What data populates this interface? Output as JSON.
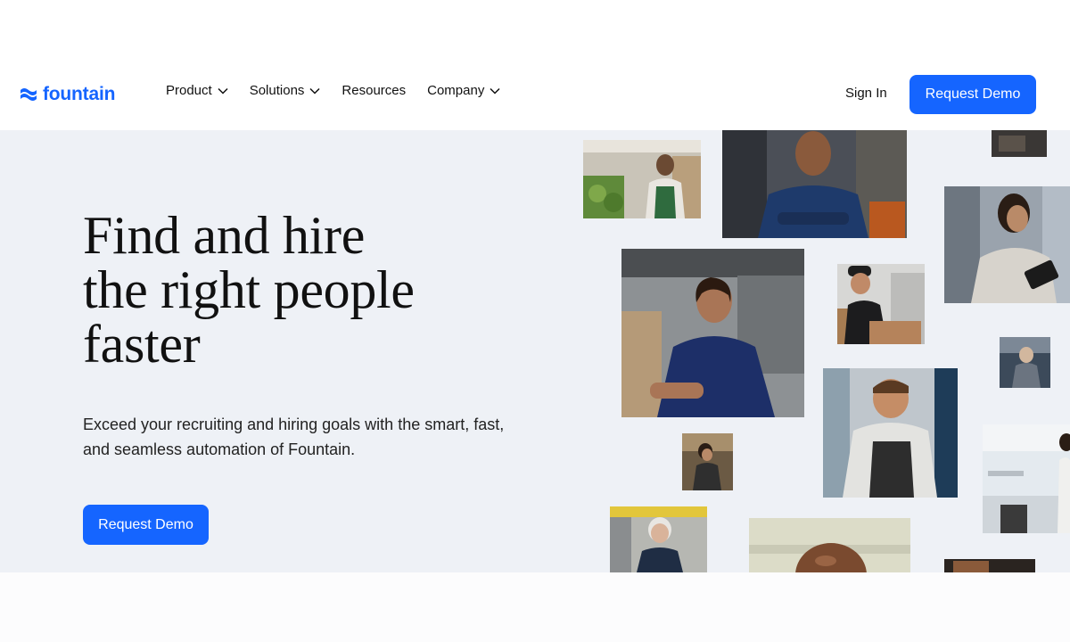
{
  "brand": {
    "name": "fountain",
    "color": "#1565ff",
    "logo_icon": "fountain-logo-icon"
  },
  "nav": {
    "items": [
      {
        "label": "Product",
        "has_dropdown": true
      },
      {
        "label": "Solutions",
        "has_dropdown": true
      },
      {
        "label": "Resources",
        "has_dropdown": false
      },
      {
        "label": "Company",
        "has_dropdown": true
      }
    ],
    "sign_in": "Sign In",
    "cta": "Request Demo"
  },
  "hero": {
    "headline": [
      "Find and hire",
      "the right people",
      "faster"
    ],
    "subtext": "Exceed your recruiting and hiring goals with the smart, fast, and seamless automation of Fountain.",
    "cta": "Request Demo",
    "background": "#eef1f6"
  },
  "photos": [
    "grocery-worker-photo",
    "mechanic-photo",
    "warehouse-worker-photo",
    "factory-worker-photo",
    "delivery-worker-photo",
    "cashier-photo",
    "chef-photo",
    "barista-photo",
    "restaurant-server-photo",
    "senior-worker-photo",
    "bald-worker-photo",
    "small-top-photo",
    "small-bottom-photo"
  ]
}
